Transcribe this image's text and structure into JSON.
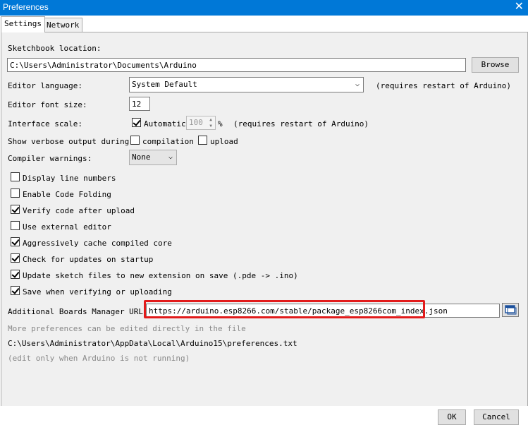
{
  "window": {
    "title": "Preferences"
  },
  "tabs": [
    {
      "label": "Settings"
    },
    {
      "label": "Network"
    }
  ],
  "sketchbook": {
    "label": "Sketchbook location:",
    "value": "C:\\Users\\Administrator\\Documents\\Arduino",
    "browse_label": "Browse"
  },
  "editor_language": {
    "label": "Editor language:",
    "value": "System Default",
    "note": "(requires restart of Arduino)"
  },
  "font_size": {
    "label": "Editor font size:",
    "value": "12"
  },
  "scale": {
    "label": "Interface scale:",
    "auto_label": "Automatic",
    "auto_checked": true,
    "value": "100",
    "unit": "%",
    "note": "(requires restart of Arduino)"
  },
  "verbose": {
    "label": "Show verbose output during:",
    "compilation_label": "compilation",
    "compilation_checked": false,
    "upload_label": "upload",
    "upload_checked": false
  },
  "warnings": {
    "label": "Compiler warnings:",
    "value": "None"
  },
  "options": [
    {
      "label": "Display line numbers",
      "checked": false
    },
    {
      "label": "Enable Code Folding",
      "checked": false
    },
    {
      "label": "Verify code after upload",
      "checked": true
    },
    {
      "label": "Use external editor",
      "checked": false
    },
    {
      "label": "Aggressively cache compiled core",
      "checked": true
    },
    {
      "label": "Check for updates on startup",
      "checked": true
    },
    {
      "label": "Update sketch files to new extension on save (.pde -> .ino)",
      "checked": true
    },
    {
      "label": "Save when verifying or uploading",
      "checked": true
    }
  ],
  "boards": {
    "label": "Additional Boards Manager URLs:",
    "value": "https://arduino.esp8266.com/stable/package_esp8266com_index.json"
  },
  "info": {
    "more": "More preferences can be edited directly in the file",
    "path": "C:\\Users\\Administrator\\AppData\\Local\\Arduino15\\preferences.txt",
    "edit_note": "(edit only when Arduino is not running)"
  },
  "buttons": {
    "ok": "OK",
    "cancel": "Cancel"
  },
  "colors": {
    "titlebar": "#0078d7",
    "highlight": "#e21b1b"
  }
}
